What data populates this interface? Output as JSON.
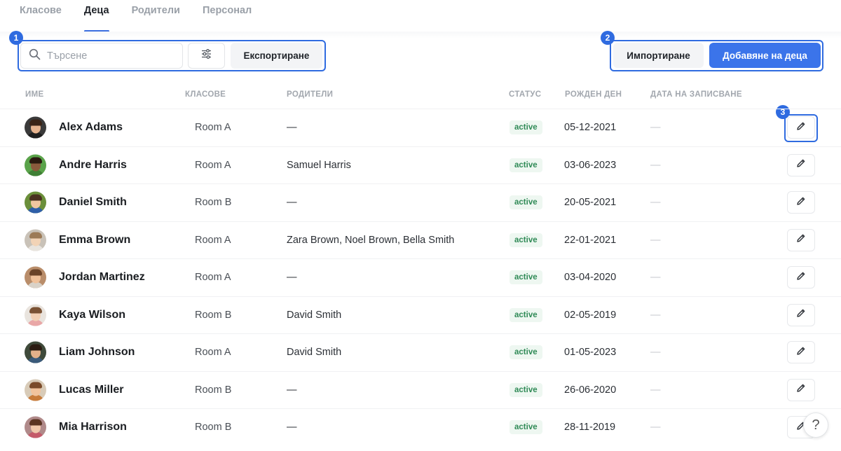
{
  "tabs": [
    {
      "label": "Класове",
      "active": false
    },
    {
      "label": "Деца",
      "active": true
    },
    {
      "label": "Родители",
      "active": false
    },
    {
      "label": "Персонал",
      "active": false
    }
  ],
  "toolbar": {
    "search_placeholder": "Търсене",
    "search_value": "",
    "export_label": "Експортиране",
    "import_label": "Импортиране",
    "add_label": "Добавяне на деца"
  },
  "annotations": [
    "1",
    "2",
    "3"
  ],
  "columns": {
    "name": "Име",
    "classes": "Класове",
    "parents": "Родители",
    "status": "Статус",
    "birthday": "Рожден ден",
    "enrollment": "Дата на записване"
  },
  "rows": [
    {
      "name": "Alex Adams",
      "room": "Room A",
      "parents": "—",
      "status": "active",
      "birthday": "05-12-2021",
      "enrollment": "—",
      "avatar": {
        "bg": "#3a3a3a",
        "skin": "#e7b48f",
        "hair": "#3b2416",
        "shirt": "#1e1e1e"
      }
    },
    {
      "name": "Andre Harris",
      "room": "Room A",
      "parents": "Samuel Harris",
      "status": "active",
      "birthday": "03-06-2023",
      "enrollment": "—",
      "avatar": {
        "bg": "#5aa34a",
        "skin": "#8a5a3c",
        "hair": "#2a1a10",
        "shirt": "#3f7f35"
      }
    },
    {
      "name": "Daniel Smith",
      "room": "Room B",
      "parents": "—",
      "status": "active",
      "birthday": "20-05-2021",
      "enrollment": "—",
      "avatar": {
        "bg": "#6b8f3a",
        "skin": "#f0c6a0",
        "hair": "#4a3020",
        "shirt": "#2f5fa8"
      }
    },
    {
      "name": "Emma Brown",
      "room": "Room A",
      "parents": "Zara Brown, Noel Brown, Bella Smith",
      "status": "active",
      "birthday": "22-01-2021",
      "enrollment": "—",
      "avatar": {
        "bg": "#c9c2b8",
        "skin": "#f2d3b6",
        "hair": "#9c7a56",
        "shirt": "#e8e4de"
      }
    },
    {
      "name": "Jordan Martinez",
      "room": "Room A",
      "parents": "—",
      "status": "active",
      "birthday": "03-04-2020",
      "enrollment": "—",
      "avatar": {
        "bg": "#b98d6a",
        "skin": "#f0c19a",
        "hair": "#6a4328",
        "shirt": "#d9d2c8"
      }
    },
    {
      "name": "Kaya Wilson",
      "room": "Room B",
      "parents": "David Smith",
      "status": "active",
      "birthday": "02-05-2019",
      "enrollment": "—",
      "avatar": {
        "bg": "#e9e4de",
        "skin": "#f3d0b4",
        "hair": "#7a5234",
        "shirt": "#e9a7a7"
      }
    },
    {
      "name": "Liam Johnson",
      "room": "Room A",
      "parents": "David Smith",
      "status": "active",
      "birthday": "01-05-2023",
      "enrollment": "—",
      "avatar": {
        "bg": "#3f4a3a",
        "skin": "#e2b08a",
        "hair": "#2c1c12",
        "shirt": "#3a5a7a"
      }
    },
    {
      "name": "Lucas Miller",
      "room": "Room B",
      "parents": "—",
      "status": "active",
      "birthday": "26-06-2020",
      "enrollment": "—",
      "avatar": {
        "bg": "#d8cbb8",
        "skin": "#f1c39c",
        "hair": "#7b4b2a",
        "shirt": "#c77b3a"
      }
    },
    {
      "name": "Mia Harrison",
      "room": "Room B",
      "parents": "—",
      "status": "active",
      "birthday": "28-11-2019",
      "enrollment": "—",
      "avatar": {
        "bg": "#b08a8a",
        "skin": "#f0c8ac",
        "hair": "#5a3422",
        "shirt": "#c45a6a"
      }
    }
  ],
  "help_label": "?",
  "colors": {
    "accent": "#3b74ea",
    "highlight": "#2f6be0",
    "status_text": "#2f8a56",
    "status_bg": "#eef7f1"
  },
  "icons": {
    "search": "search-icon",
    "filter": "sliders-icon",
    "edit": "pencil-icon",
    "help": "question-icon"
  }
}
